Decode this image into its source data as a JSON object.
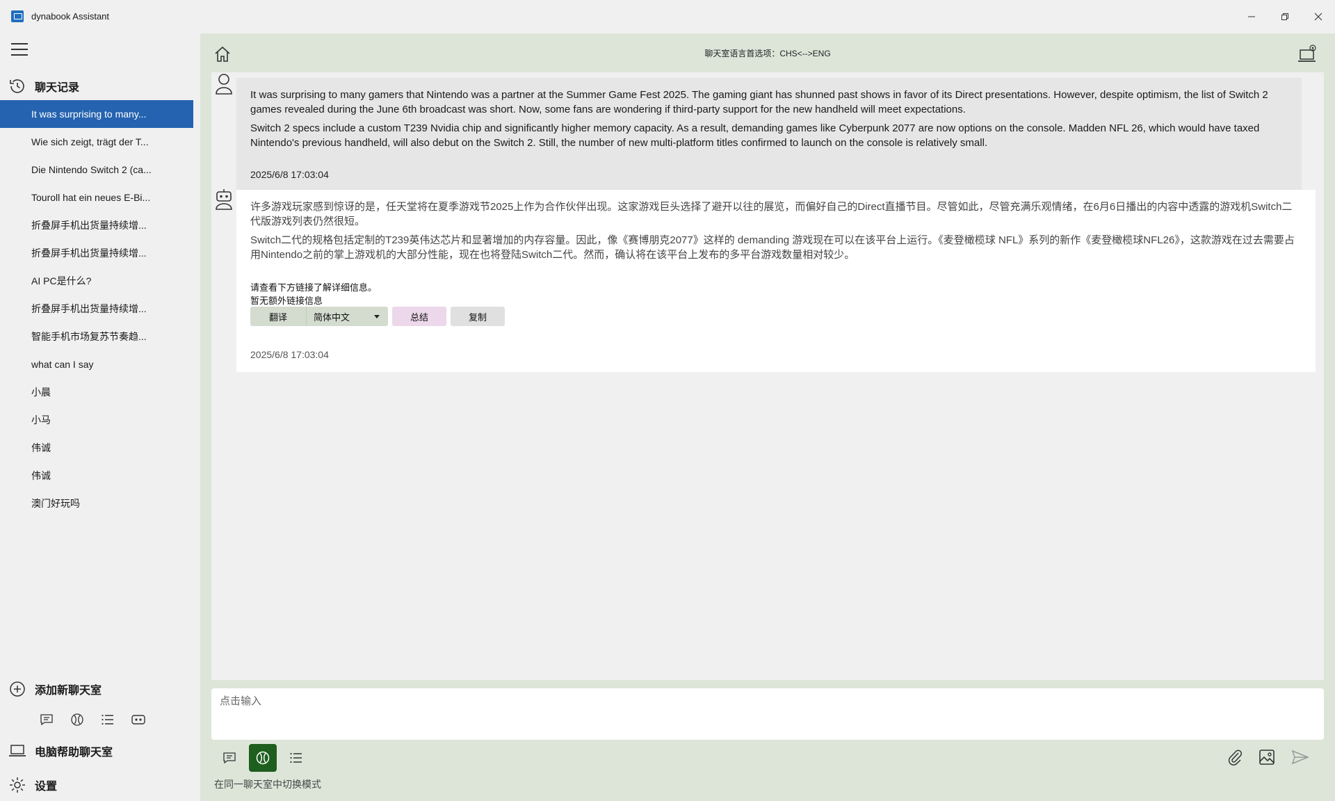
{
  "window": {
    "title": "dynabook Assistant",
    "icon": "app-icon",
    "controls": [
      "minimize-icon",
      "restore-icon",
      "close-icon"
    ]
  },
  "sidebar": {
    "history_label": "聊天记录",
    "items": [
      {
        "label": "It was surprising to many...",
        "active": true
      },
      {
        "label": "Wie sich zeigt, trägt der T..."
      },
      {
        "label": "Die Nintendo Switch 2 (ca..."
      },
      {
        "label": "Touroll hat ein neues E-Bi..."
      },
      {
        "label": "折叠屏手机出货量持续增..."
      },
      {
        "label": "折叠屏手机出货量持续增..."
      },
      {
        "label": "AI PC是什么?"
      },
      {
        "label": "折叠屏手机出货量持续增..."
      },
      {
        "label": "智能手机市场复苏节奏趋..."
      },
      {
        "label": "what can I say"
      },
      {
        "label": "小晨"
      },
      {
        "label": "小马"
      },
      {
        "label": "伟诚"
      },
      {
        "label": "伟诚"
      },
      {
        "label": "澳门好玩吗"
      }
    ],
    "add_room_label": "添加新聊天室",
    "pc_room_label": "电脑帮助聊天室",
    "settings_label": "设置"
  },
  "header": {
    "lang_pref": "聊天室语言首选项：CHS<-->ENG"
  },
  "messages": {
    "user": {
      "paragraphs": [
        "It was surprising to many gamers that Nintendo was a partner at the Summer Game Fest 2025. The gaming giant has shunned past shows in favor of its Direct presentations. However, despite optimism, the list of Switch 2 games revealed during the June 6th broadcast was short. Now, some fans are wondering if third-party support for the new handheld will meet expectations.",
        "Switch 2 specs include a custom T239 Nvidia chip and significantly higher memory capacity. As a result, demanding games like Cyberpunk 2077 are now options on the console. Madden NFL 26, which would have taxed Nintendo's previous handheld, will also debut on the Switch 2. Still, the number of new multi-platform titles confirmed to launch on the console is relatively small."
      ],
      "time": "2025/6/8 17:03:04"
    },
    "bot": {
      "paragraphs": [
        "许多游戏玩家感到惊讶的是，任天堂将在夏季游戏节2025上作为合作伙伴出现。这家游戏巨头选择了避开以往的展览，而偏好自己的Direct直播节目。尽管如此，尽管充满乐观情绪，在6月6日播出的内容中透露的游戏机Switch二代版游戏列表仍然很短。",
        "Switch二代的规格包括定制的T239英伟达芯片和显著增加的内存容量。因此，像《赛博朋克2077》这样的 demanding 游戏现在可以在该平台上运行。《麦登橄榄球 NFL》系列的新作《麦登橄榄球NFL26》，这款游戏在过去需要占用Nintendo之前的掌上游戏机的大部分性能，现在也将登陆Switch二代。然而，确认将在该平台上发布的多平台游戏数量相对较少。"
      ],
      "see_below": "请查看下方链接了解详细信息。",
      "no_links": "暂无额外链接信息",
      "buttons": {
        "translate": "翻译",
        "language": "简体中文",
        "summary": "总结",
        "copy": "复制"
      },
      "time": "2025/6/8 17:03:04"
    }
  },
  "input": {
    "placeholder": "点击输入"
  },
  "footer": {
    "mode_hint": "在同一聊天室中切换模式",
    "active_mode": "globe-mode"
  },
  "colors": {
    "accent": "#2563b0",
    "main_bg": "#dde5d9",
    "active_mode": "#1e5e1e",
    "summary_btn": "#ecd8ea"
  }
}
